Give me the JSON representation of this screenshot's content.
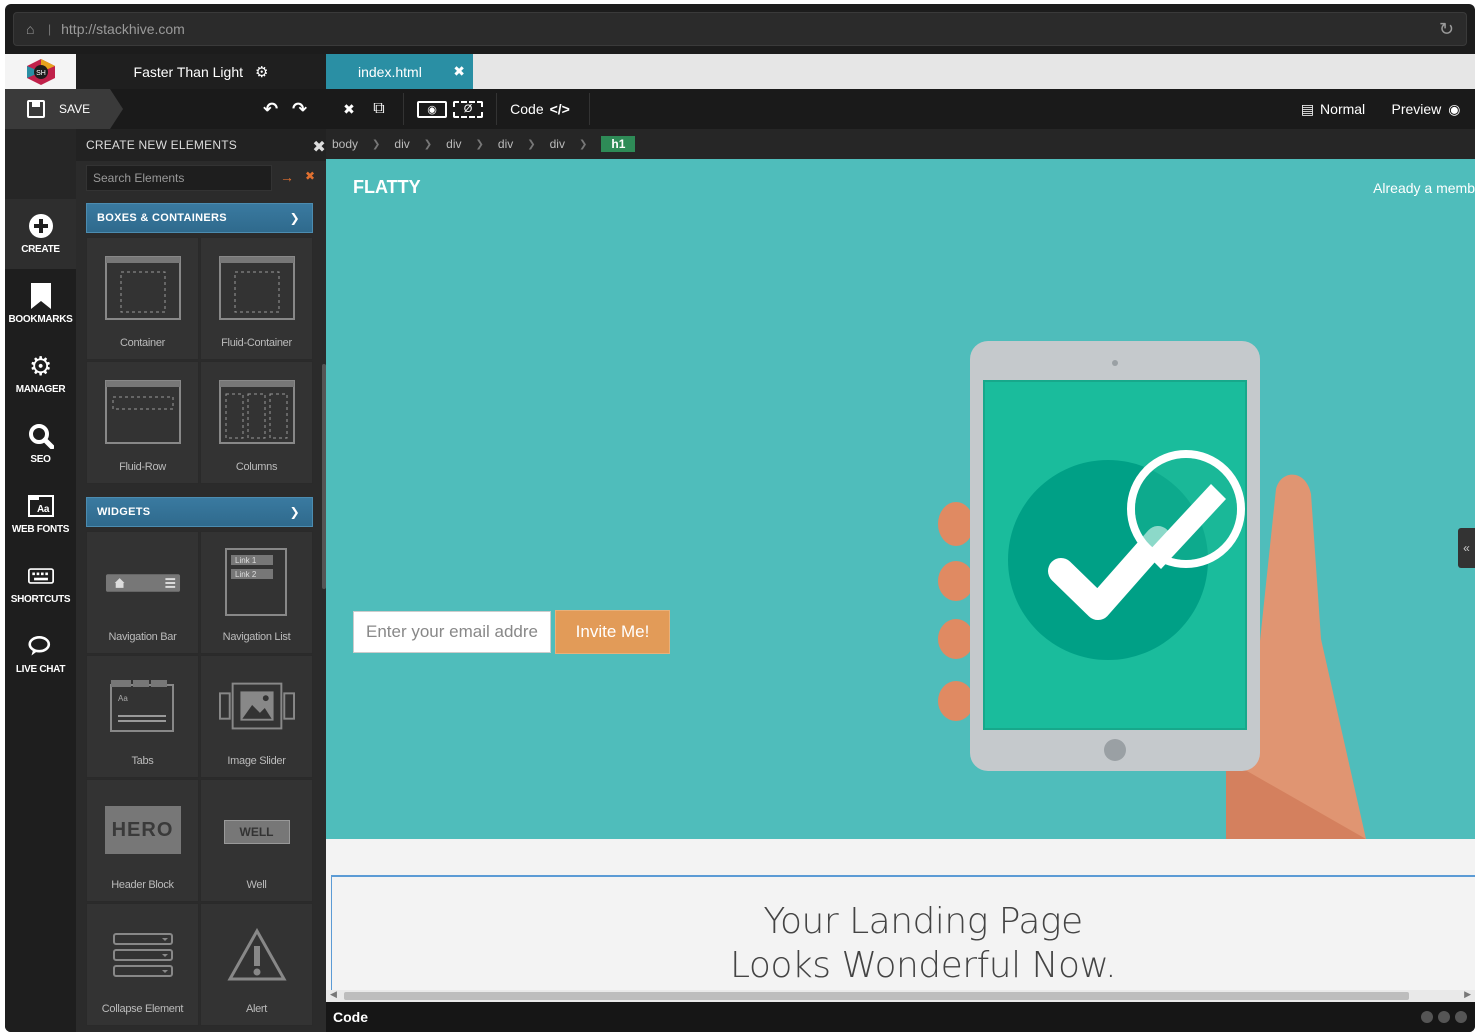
{
  "browser": {
    "url": "http://stackhive.com"
  },
  "tabs": {
    "project": "Faster Than Light",
    "file": "index.html"
  },
  "toolbar": {
    "save": "SAVE",
    "code": "Code",
    "normal": "Normal",
    "preview": "Preview"
  },
  "iconbar": [
    {
      "label": "CREATE",
      "icon": "plus-circle-icon"
    },
    {
      "label": "BOOKMARKS",
      "icon": "bookmark-icon"
    },
    {
      "label": "MANAGER",
      "icon": "gears-icon"
    },
    {
      "label": "SEO",
      "icon": "search-icon"
    },
    {
      "label": "WEB FONTS",
      "icon": "font-icon"
    },
    {
      "label": "SHORTCUTS",
      "icon": "keyboard-icon"
    },
    {
      "label": "LIVE CHAT",
      "icon": "chat-icon"
    }
  ],
  "panel": {
    "title": "CREATE NEW ELEMENTS",
    "search_placeholder": "Search Elements",
    "sections": [
      {
        "title": "BOXES & CONTAINERS",
        "items": [
          "Container",
          "Fluid-Container",
          "Fluid-Row",
          "Columns"
        ]
      },
      {
        "title": "WIDGETS",
        "items": [
          "Navigation Bar",
          "Navigation List",
          "Tabs",
          "Image Slider",
          "Header Block",
          "Well",
          "Collapse Element",
          "Alert"
        ]
      }
    ],
    "thumb_text": {
      "link1": "Link 1",
      "link2": "Link 2",
      "hero": "HERO",
      "well": "WELL",
      "tabs_aa": "Aa"
    }
  },
  "breadcrumb": [
    "body",
    "div",
    "div",
    "div",
    "div",
    "h1"
  ],
  "canvas": {
    "brand": "FLATTY",
    "member": "Already a memb",
    "email_placeholder": "Enter your email addre",
    "invite": "Invite Me!",
    "headline_1": "Your Landing Page",
    "headline_2": "Looks Wonderful Now."
  },
  "codebar": {
    "label": "Code"
  },
  "colors": {
    "hero_bg": "#4fbdbb",
    "tab_active": "#2a8fa4",
    "section_blue": "#2f6a8d",
    "invite": "#e29b58",
    "crumb_active": "#2e8b57"
  }
}
